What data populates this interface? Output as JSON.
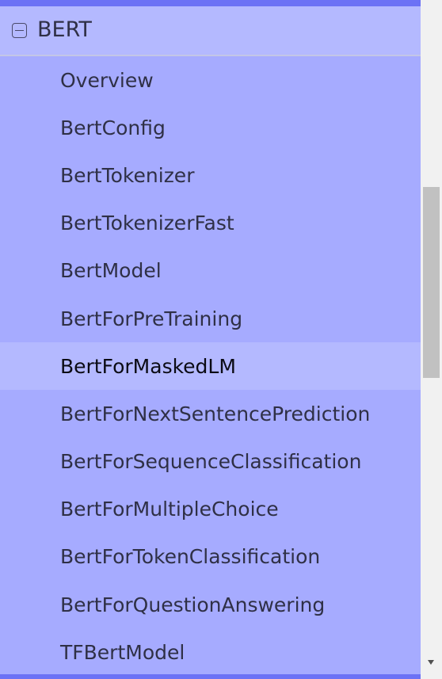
{
  "section": {
    "title": "BERT",
    "icon": "collapse-minus-icon"
  },
  "nav": {
    "items": [
      {
        "label": "Overview",
        "active": false
      },
      {
        "label": "BertConfig",
        "active": false
      },
      {
        "label": "BertTokenizer",
        "active": false
      },
      {
        "label": "BertTokenizerFast",
        "active": false
      },
      {
        "label": "BertModel",
        "active": false
      },
      {
        "label": "BertForPreTraining",
        "active": false
      },
      {
        "label": "BertForMaskedLM",
        "active": true
      },
      {
        "label": "BertForNextSentencePrediction",
        "active": false
      },
      {
        "label": "BertForSequenceClassification",
        "active": false
      },
      {
        "label": "BertForMultipleChoice",
        "active": false
      },
      {
        "label": "BertForTokenClassification",
        "active": false
      },
      {
        "label": "BertForQuestionAnswering",
        "active": false
      },
      {
        "label": "TFBertModel",
        "active": false
      }
    ]
  },
  "colors": {
    "nav_background": "#a6abff",
    "header_background": "#b4b9ff",
    "accent_bar": "#6c72f5",
    "active_background": "#b4b9ff",
    "text": "#2f3046"
  }
}
